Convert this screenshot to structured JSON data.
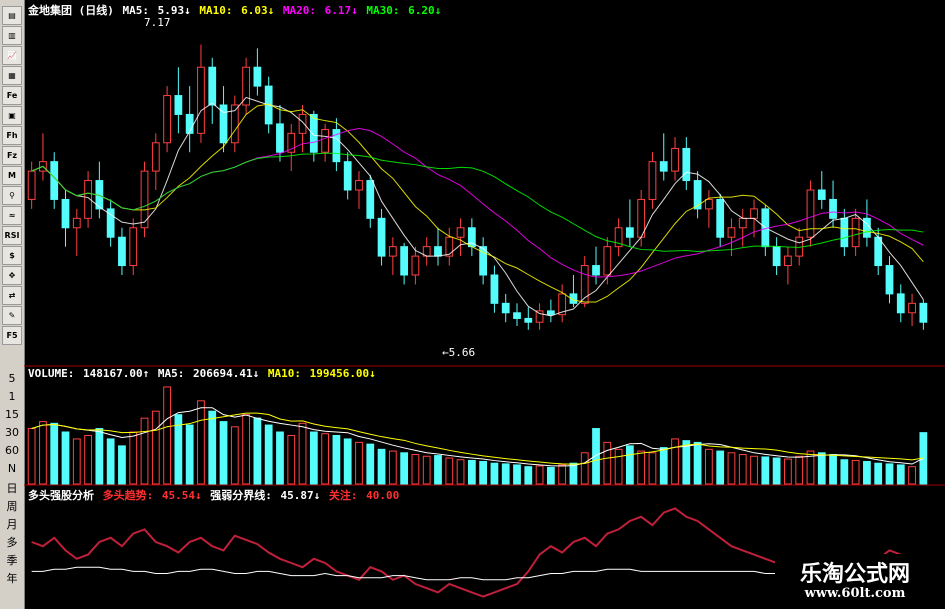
{
  "toolbar": {
    "buttons": [
      "▤",
      "▥",
      "📈",
      "▦",
      "Fe",
      "▣",
      "Fh",
      "Fz",
      "M",
      "⚲",
      "≈",
      "RSI",
      "$",
      "✥",
      "⇄",
      "✎",
      "F5"
    ],
    "labels": [
      "5",
      "1",
      "15",
      "30",
      "60",
      "N",
      "日",
      "周",
      "月",
      "多",
      "季",
      "年"
    ]
  },
  "price_panel": {
    "stock_name": "金地集团 (日线)",
    "ma5_label": "MA5:",
    "ma5_value": "5.93↓",
    "ma10_label": "MA10:",
    "ma10_value": "6.03↓",
    "ma20_label": "MA20:",
    "ma20_value": "6.17↓",
    "ma30_label": "MA30:",
    "ma30_value": "6.20↓",
    "high_label": "7.17",
    "low_label": "←5.66"
  },
  "volume_panel": {
    "title": "VOLUME:",
    "value": "148167.00↑",
    "ma5_label": "MA5:",
    "ma5_value": "206694.41↓",
    "ma10_label": "MA10:",
    "ma10_value": "199456.00↓"
  },
  "indicator_panel": {
    "title": "多头强股分析",
    "line1_label": "多头趋势:",
    "line1_value": "45.54↓",
    "line2_label": "强弱分界线:",
    "line2_value": "45.87↓",
    "line3_label": "关注:",
    "line3_value": "40.00"
  },
  "watermark": {
    "name": "乐淘公式网",
    "url": "www.60lt.com"
  },
  "colors": {
    "up": "#ff4040",
    "down": "#54fcfc",
    "ma5": "#ffffff",
    "ma10": "#ffff00",
    "ma20": "#ff00ff",
    "ma30": "#00ff00",
    "trend": "#c0203a",
    "divider": "#ffffff"
  },
  "chart_data": [
    {
      "type": "candlestick",
      "title": "金地集团 (日线)",
      "note": "daily candles; values approximated from screenshot",
      "ylim": [
        5.5,
        7.3
      ],
      "ohlc": [
        [
          6.35,
          6.55,
          6.3,
          6.5
        ],
        [
          6.5,
          6.7,
          6.45,
          6.55
        ],
        [
          6.55,
          6.6,
          6.3,
          6.35
        ],
        [
          6.35,
          6.4,
          6.1,
          6.2
        ],
        [
          6.2,
          6.3,
          6.05,
          6.25
        ],
        [
          6.25,
          6.5,
          6.2,
          6.45
        ],
        [
          6.45,
          6.55,
          6.25,
          6.3
        ],
        [
          6.3,
          6.35,
          6.1,
          6.15
        ],
        [
          6.15,
          6.2,
          5.95,
          6.0
        ],
        [
          6.0,
          6.25,
          5.95,
          6.2
        ],
        [
          6.2,
          6.55,
          6.15,
          6.5
        ],
        [
          6.5,
          6.7,
          6.4,
          6.65
        ],
        [
          6.65,
          6.95,
          6.6,
          6.9
        ],
        [
          6.9,
          7.05,
          6.7,
          6.8
        ],
        [
          6.8,
          6.95,
          6.6,
          6.7
        ],
        [
          6.7,
          7.17,
          6.65,
          7.05
        ],
        [
          7.05,
          7.1,
          6.75,
          6.85
        ],
        [
          6.85,
          6.95,
          6.6,
          6.65
        ],
        [
          6.65,
          6.9,
          6.6,
          6.85
        ],
        [
          6.85,
          7.1,
          6.8,
          7.05
        ],
        [
          7.05,
          7.15,
          6.9,
          6.95
        ],
        [
          6.95,
          7.0,
          6.7,
          6.75
        ],
        [
          6.75,
          6.85,
          6.55,
          6.6
        ],
        [
          6.6,
          6.75,
          6.5,
          6.7
        ],
        [
          6.7,
          6.85,
          6.6,
          6.8
        ],
        [
          6.8,
          6.82,
          6.55,
          6.6
        ],
        [
          6.6,
          6.75,
          6.55,
          6.72
        ],
        [
          6.72,
          6.78,
          6.5,
          6.55
        ],
        [
          6.55,
          6.6,
          6.35,
          6.4
        ],
        [
          6.4,
          6.5,
          6.3,
          6.45
        ],
        [
          6.45,
          6.48,
          6.2,
          6.25
        ],
        [
          6.25,
          6.3,
          6.0,
          6.05
        ],
        [
          6.05,
          6.15,
          5.95,
          6.1
        ],
        [
          6.1,
          6.12,
          5.9,
          5.95
        ],
        [
          5.95,
          6.1,
          5.9,
          6.05
        ],
        [
          6.05,
          6.15,
          6.0,
          6.1
        ],
        [
          6.1,
          6.2,
          6.0,
          6.05
        ],
        [
          6.05,
          6.2,
          6.0,
          6.15
        ],
        [
          6.15,
          6.25,
          6.05,
          6.2
        ],
        [
          6.2,
          6.25,
          6.05,
          6.1
        ],
        [
          6.1,
          6.15,
          5.9,
          5.95
        ],
        [
          5.95,
          6.0,
          5.75,
          5.8
        ],
        [
          5.8,
          5.85,
          5.7,
          5.75
        ],
        [
          5.75,
          5.8,
          5.68,
          5.72
        ],
        [
          5.72,
          5.78,
          5.66,
          5.7
        ],
        [
          5.7,
          5.8,
          5.66,
          5.76
        ],
        [
          5.76,
          5.82,
          5.7,
          5.74
        ],
        [
          5.74,
          5.9,
          5.7,
          5.85
        ],
        [
          5.85,
          5.95,
          5.78,
          5.8
        ],
        [
          5.8,
          6.05,
          5.78,
          6.0
        ],
        [
          6.0,
          6.1,
          5.9,
          5.95
        ],
        [
          5.95,
          6.15,
          5.9,
          6.1
        ],
        [
          6.1,
          6.25,
          6.05,
          6.2
        ],
        [
          6.2,
          6.35,
          6.1,
          6.15
        ],
        [
          6.15,
          6.4,
          6.1,
          6.35
        ],
        [
          6.35,
          6.6,
          6.3,
          6.55
        ],
        [
          6.55,
          6.7,
          6.45,
          6.5
        ],
        [
          6.5,
          6.68,
          6.45,
          6.62
        ],
        [
          6.62,
          6.68,
          6.4,
          6.45
        ],
        [
          6.45,
          6.5,
          6.25,
          6.3
        ],
        [
          6.3,
          6.4,
          6.2,
          6.35
        ],
        [
          6.35,
          6.38,
          6.1,
          6.15
        ],
        [
          6.15,
          6.25,
          6.05,
          6.2
        ],
        [
          6.2,
          6.3,
          6.1,
          6.25
        ],
        [
          6.25,
          6.35,
          6.15,
          6.3
        ],
        [
          6.3,
          6.32,
          6.05,
          6.1
        ],
        [
          6.1,
          6.15,
          5.95,
          6.0
        ],
        [
          6.0,
          6.1,
          5.9,
          6.05
        ],
        [
          6.05,
          6.2,
          6.0,
          6.15
        ],
        [
          6.15,
          6.45,
          6.1,
          6.4
        ],
        [
          6.4,
          6.5,
          6.3,
          6.35
        ],
        [
          6.35,
          6.45,
          6.2,
          6.25
        ],
        [
          6.25,
          6.3,
          6.05,
          6.1
        ],
        [
          6.1,
          6.3,
          6.05,
          6.25
        ],
        [
          6.25,
          6.35,
          6.1,
          6.15
        ],
        [
          6.15,
          6.2,
          5.95,
          6.0
        ],
        [
          6.0,
          6.05,
          5.8,
          5.85
        ],
        [
          5.85,
          5.9,
          5.7,
          5.75
        ],
        [
          5.75,
          5.85,
          5.68,
          5.8
        ],
        [
          5.8,
          5.82,
          5.66,
          5.7
        ]
      ],
      "ma_series": [
        {
          "name": "MA5",
          "period": 5
        },
        {
          "name": "MA10",
          "period": 10
        },
        {
          "name": "MA20",
          "period": 20
        },
        {
          "name": "MA30",
          "period": 30
        }
      ]
    },
    {
      "type": "bar",
      "title": "VOLUME",
      "ylim": [
        0,
        300000
      ],
      "values": [
        160000,
        180000,
        175000,
        150000,
        130000,
        140000,
        160000,
        130000,
        110000,
        150000,
        190000,
        210000,
        280000,
        200000,
        170000,
        240000,
        210000,
        180000,
        165000,
        200000,
        190000,
        170000,
        150000,
        140000,
        175000,
        150000,
        145000,
        140000,
        130000,
        120000,
        115000,
        100000,
        95000,
        90000,
        85000,
        80000,
        82000,
        75000,
        70000,
        68000,
        65000,
        60000,
        58000,
        55000,
        50000,
        52000,
        48000,
        55000,
        60000,
        90000,
        160000,
        120000,
        100000,
        110000,
        95000,
        90000,
        105000,
        130000,
        125000,
        120000,
        100000,
        95000,
        90000,
        85000,
        80000,
        78000,
        75000,
        72000,
        80000,
        95000,
        90000,
        85000,
        70000,
        68000,
        65000,
        60000,
        58000,
        55000,
        50000,
        148167
      ]
    },
    {
      "type": "line",
      "title": "多头强股分析",
      "ylim": [
        30,
        80
      ],
      "series": [
        {
          "name": "多头趋势",
          "values": [
            60,
            58,
            62,
            56,
            52,
            54,
            60,
            62,
            58,
            64,
            66,
            60,
            58,
            55,
            60,
            62,
            58,
            56,
            63,
            61,
            59,
            55,
            52,
            50,
            48,
            52,
            50,
            46,
            44,
            42,
            48,
            46,
            42,
            44,
            40,
            38,
            36,
            40,
            38,
            36,
            34,
            36,
            38,
            40,
            46,
            54,
            58,
            55,
            60,
            62,
            58,
            64,
            66,
            70,
            72,
            68,
            74,
            76,
            72,
            70,
            66,
            62,
            58,
            56,
            54,
            52,
            50,
            46,
            44,
            48,
            50,
            48,
            46,
            44,
            48,
            52,
            56,
            54,
            50,
            45.54
          ]
        },
        {
          "name": "强弱分界线",
          "values": [
            46,
            46,
            47,
            47,
            48,
            48,
            48,
            47,
            47,
            46,
            46,
            45,
            45,
            46,
            46,
            47,
            47,
            46,
            45,
            45,
            46,
            46,
            45,
            44,
            44,
            44,
            45,
            44,
            44,
            43,
            43,
            43,
            44,
            44,
            43,
            42,
            42,
            42,
            43,
            43,
            42,
            42,
            42,
            43,
            43,
            44,
            45,
            45,
            46,
            46,
            46,
            47,
            47,
            47,
            46,
            46,
            46,
            46,
            46,
            46,
            46,
            46,
            46,
            46,
            46,
            45,
            45,
            45,
            45,
            46,
            46,
            46,
            46,
            46,
            46,
            46,
            46,
            46,
            46,
            45.87
          ]
        }
      ]
    }
  ]
}
